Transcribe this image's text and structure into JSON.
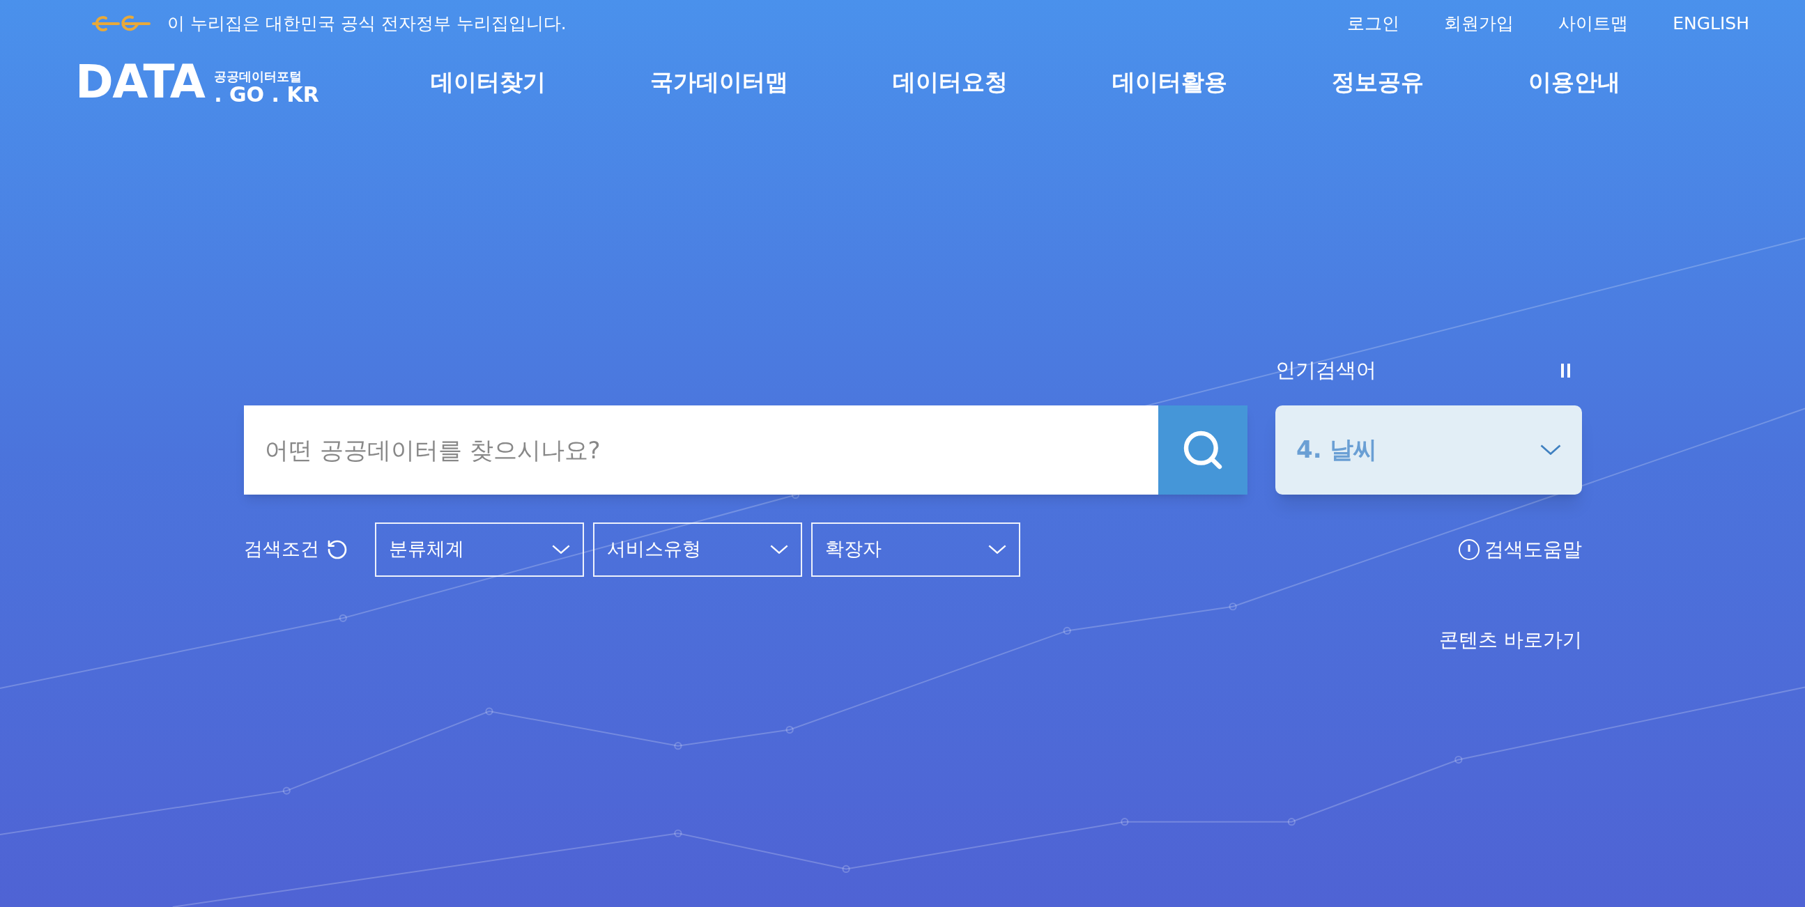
{
  "banner": {
    "text": "이 누리집은 대한민국 공식 전자정부 누리집입니다."
  },
  "utility_links": [
    "로그인",
    "회원가입",
    "사이트맵",
    "ENGLISH"
  ],
  "logo": {
    "main": "DATA",
    "subtitle": "공공데이터포털",
    "domain": ". GO . KR"
  },
  "nav": [
    "데이터찾기",
    "국가데이터맵",
    "데이터요청",
    "데이터활용",
    "정보공유",
    "이용안내"
  ],
  "search": {
    "placeholder": "어떤 공공데이터를 찾으시나요?"
  },
  "popular": {
    "title": "인기검색어",
    "current": "4. 날씨"
  },
  "filters": {
    "label": "검색조건",
    "selects": [
      "분류체계",
      "서비스유형",
      "확장자"
    ]
  },
  "help_link": "검색도움말",
  "content_link": "콘텐츠 바로가기"
}
